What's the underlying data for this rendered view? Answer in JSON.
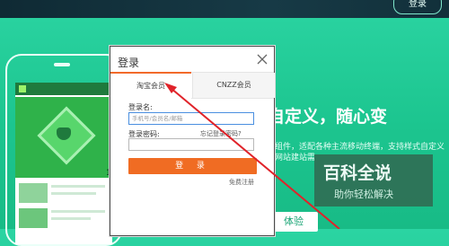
{
  "header": {
    "login_button": "登录"
  },
  "hero": {
    "headline": "自定义，随心变",
    "subtext_line1": "组件，适配各种主流移动终端，支持样式自定义",
    "subtext_line2": "网站建站需",
    "cta": "体验",
    "phone_edge_number": "1"
  },
  "modal": {
    "title": "登录",
    "tabs": [
      {
        "label": "淘宝会员",
        "active": true
      },
      {
        "label": "CNZZ会员",
        "active": false
      }
    ],
    "username_label": "登录名:",
    "username_placeholder": "手机号/会员名/邮箱",
    "password_label": "登录密码:",
    "forgot_link": "忘记登录密码?",
    "submit_label": "登 录",
    "register_link": "免费注册"
  },
  "watermark": {
    "title": "百科全说",
    "subtitle": "助你轻松解决"
  },
  "colors": {
    "accent": "#f06c23",
    "background": "#1cc58f",
    "annotation_arrow": "#e0232a"
  }
}
